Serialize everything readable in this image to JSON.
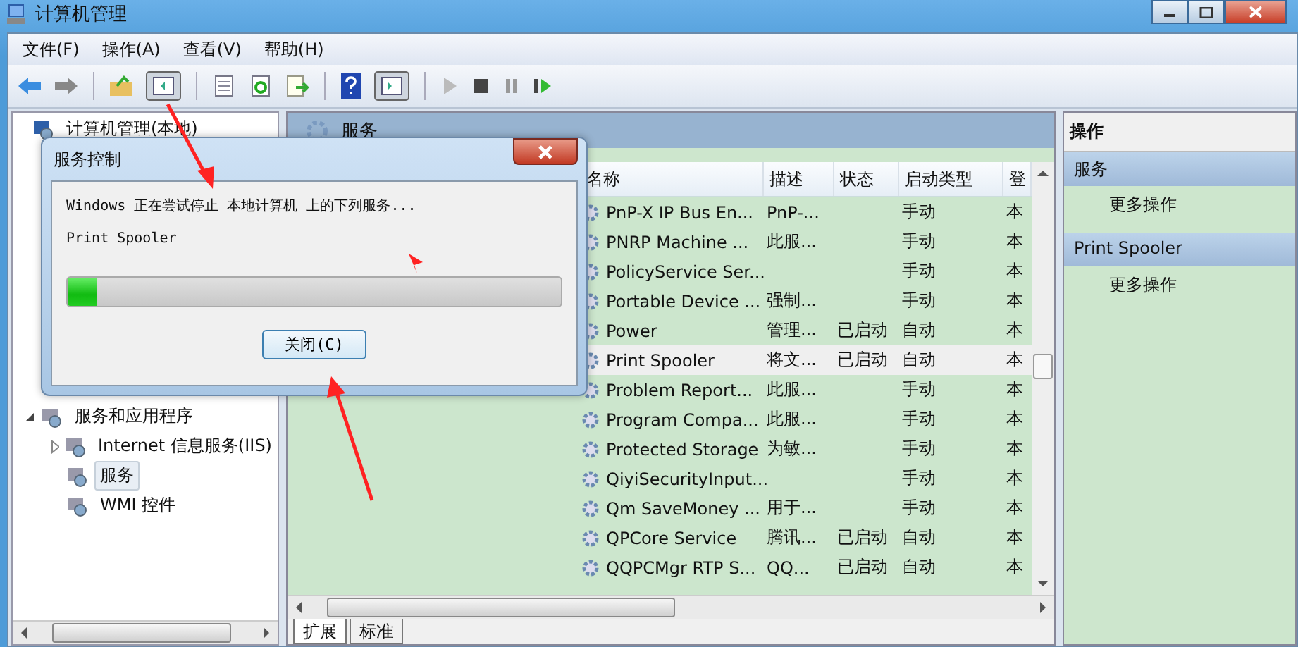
{
  "window": {
    "title": "计算机管理"
  },
  "menu": [
    "文件(F)",
    "操作(A)",
    "查看(V)",
    "帮助(H)"
  ],
  "tree": [
    {
      "label": "计算机管理(本地)",
      "selected": false,
      "children": [
        {
          "label": "服务和应用程序",
          "selected": false,
          "expanded": true,
          "children": [
            {
              "label": "Internet 信息服务(IIS)",
              "selected": false,
              "expanded": false
            },
            {
              "label": "服务",
              "selected": true
            },
            {
              "label": "WMI 控件",
              "selected": false
            }
          ]
        }
      ]
    }
  ],
  "center": {
    "title": "服务"
  },
  "table": {
    "columns": [
      "名称",
      "描述",
      "状态",
      "启动类型",
      "登"
    ],
    "rows": [
      {
        "cells": [
          "PnP-X IP Bus En...",
          "PnP-...",
          "",
          "手动",
          "本"
        ],
        "selected": false
      },
      {
        "cells": [
          "PNRP Machine ...",
          "此服...",
          "",
          "手动",
          "本"
        ],
        "selected": false
      },
      {
        "cells": [
          "PolicyService Ser...",
          "",
          "",
          "手动",
          "本"
        ],
        "selected": false
      },
      {
        "cells": [
          "Portable Device ...",
          "强制...",
          "",
          "手动",
          "本"
        ],
        "selected": false
      },
      {
        "cells": [
          "Power",
          "管理...",
          "已启动",
          "自动",
          "本"
        ],
        "selected": false
      },
      {
        "cells": [
          "Print Spooler",
          "将文...",
          "已启动",
          "自动",
          "本"
        ],
        "selected": true
      },
      {
        "cells": [
          "Problem Report...",
          "此服...",
          "",
          "手动",
          "本"
        ],
        "selected": false
      },
      {
        "cells": [
          "Program Compa...",
          "此服...",
          "",
          "手动",
          "本"
        ],
        "selected": false
      },
      {
        "cells": [
          "Protected Storage",
          "为敏...",
          "",
          "手动",
          "本"
        ],
        "selected": false
      },
      {
        "cells": [
          "QiyiSecurityInput...",
          "",
          "",
          "手动",
          "本"
        ],
        "selected": false
      },
      {
        "cells": [
          "Qm SaveMoney ...",
          "用于...",
          "",
          "手动",
          "本"
        ],
        "selected": false
      },
      {
        "cells": [
          "QPCore Service",
          "腾讯...",
          "已启动",
          "自动",
          "本"
        ],
        "selected": false
      },
      {
        "cells": [
          "QQPCMgr RTP S...",
          "QQ...",
          "已启动",
          "自动",
          "本"
        ],
        "selected": false
      }
    ]
  },
  "bottom_tabs": [
    {
      "label": "扩展",
      "selected": true
    },
    {
      "label": "标准",
      "selected": false
    }
  ],
  "actions": {
    "title": "操作",
    "sections": [
      {
        "title": "服务",
        "items": [
          "更多操作"
        ]
      },
      {
        "title": "Print Spooler",
        "items": [
          "更多操作"
        ]
      }
    ]
  },
  "dialog": {
    "title": "服务控制",
    "message": "Windows 正在尝试停止 本地计算机 上的下列服务...",
    "service": "Print Spooler",
    "level": 0.06,
    "button": "关闭(C)"
  }
}
